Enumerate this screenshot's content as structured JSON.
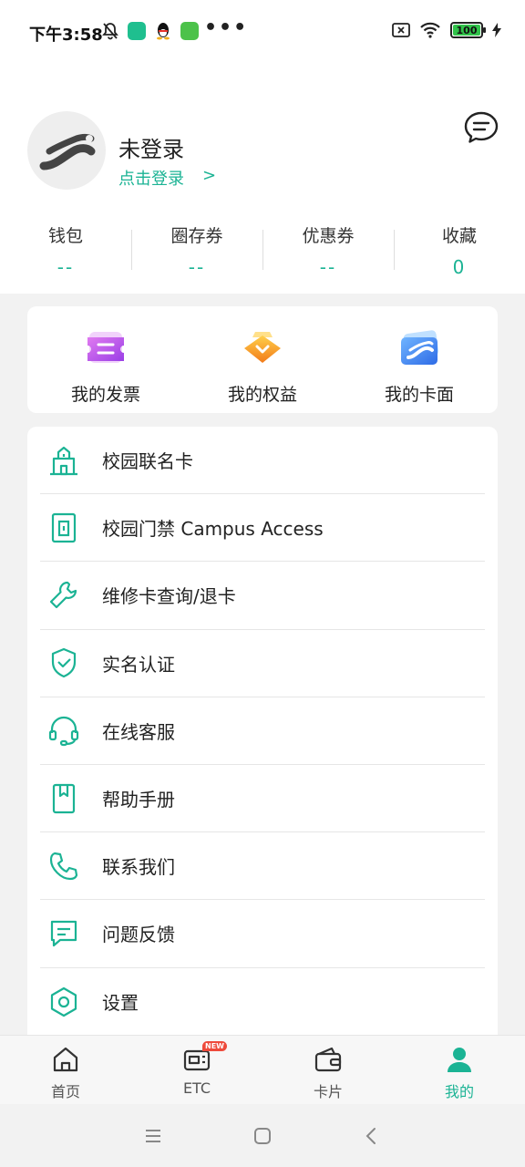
{
  "status_bar": {
    "time": "下午3:58",
    "battery": "100",
    "more": "•••"
  },
  "profile": {
    "name": "未登录",
    "login_link": "点击登录",
    "login_arrow": ">"
  },
  "stats": [
    {
      "label": "钱包",
      "value": "--"
    },
    {
      "label": "圈存券",
      "value": "--"
    },
    {
      "label": "优惠券",
      "value": "--"
    },
    {
      "label": "收藏",
      "value": "0"
    }
  ],
  "quick_actions": [
    {
      "label": "我的发票",
      "icon": "invoice-icon"
    },
    {
      "label": "我的权益",
      "icon": "benefits-icon"
    },
    {
      "label": "我的卡面",
      "icon": "card-face-icon"
    }
  ],
  "menu": [
    {
      "label": "校园联名卡",
      "icon": "campus-building-icon"
    },
    {
      "label": "校园门禁 Campus Access",
      "icon": "door-icon"
    },
    {
      "label": "维修卡查询/退卡",
      "icon": "wrench-icon"
    },
    {
      "label": "实名认证",
      "icon": "shield-check-icon"
    },
    {
      "label": "在线客服",
      "icon": "headset-icon"
    },
    {
      "label": "帮助手册",
      "icon": "book-icon"
    },
    {
      "label": "联系我们",
      "icon": "phone-icon"
    },
    {
      "label": "问题反馈",
      "icon": "feedback-icon"
    },
    {
      "label": "设置",
      "icon": "settings-icon"
    }
  ],
  "tabbar": [
    {
      "label": "首页",
      "icon": "home-icon",
      "active": false
    },
    {
      "label": "ETC",
      "icon": "etc-icon",
      "active": false,
      "badge": "NEW"
    },
    {
      "label": "卡片",
      "icon": "wallet-icon",
      "active": false
    },
    {
      "label": "我的",
      "icon": "person-icon",
      "active": true
    }
  ],
  "colors": {
    "accent": "#1bb394",
    "background": "#f2f2f2"
  }
}
